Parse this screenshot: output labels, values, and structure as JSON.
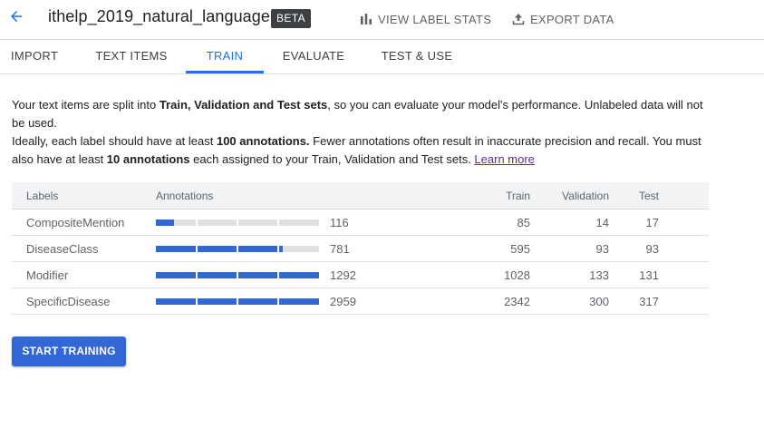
{
  "header": {
    "back_icon": "arrow-back-icon",
    "title": "ithelp_2019_natural_language",
    "badge": "BETA",
    "actions": [
      {
        "icon": "bar-chart-icon",
        "label": "VIEW LABEL STATS"
      },
      {
        "icon": "upload-icon",
        "label": "EXPORT DATA"
      }
    ]
  },
  "tabs": [
    {
      "label": "IMPORT",
      "active": false
    },
    {
      "label": "TEXT ITEMS",
      "active": false
    },
    {
      "label": "TRAIN",
      "active": true
    },
    {
      "label": "EVALUATE",
      "active": false
    },
    {
      "label": "TEST & USE",
      "active": false
    }
  ],
  "description": {
    "p1_a": "Your text items are split into ",
    "p1_b": "Train, Validation and Test sets",
    "p1_c": ", so you can evaluate your model's performance. Unlabeled data will not be used.",
    "p2_a": "Ideally, each label should have at least ",
    "p2_b": "100 annotations.",
    "p2_c": " Fewer annotations often result in inaccurate precision and recall. You must also have at least ",
    "p2_d": "10 annotations",
    "p2_e": " each assigned to your Train, Validation and Test sets. ",
    "link": "Learn more"
  },
  "table": {
    "headers": {
      "labels": "Labels",
      "annotations": "Annotations",
      "train": "Train",
      "validation": "Validation",
      "test": "Test"
    },
    "rows": [
      {
        "label": "CompositeMention",
        "annotations": "116",
        "progress": 0.11,
        "train": "85",
        "validation": "14",
        "test": "17"
      },
      {
        "label": "DiseaseClass",
        "annotations": "781",
        "progress": 0.78,
        "train": "595",
        "validation": "93",
        "test": "93"
      },
      {
        "label": "Modifier",
        "annotations": "1292",
        "progress": 1.0,
        "train": "1028",
        "validation": "133",
        "test": "131"
      },
      {
        "label": "SpecificDisease",
        "annotations": "2959",
        "progress": 1.0,
        "train": "2342",
        "validation": "300",
        "test": "317"
      }
    ]
  },
  "start_button": "START TRAINING",
  "colors": {
    "accent": "#1a73e8",
    "bar_fill": "#3367d6",
    "bar_track": "#e0e0e0",
    "link": "#5f2b8c"
  }
}
